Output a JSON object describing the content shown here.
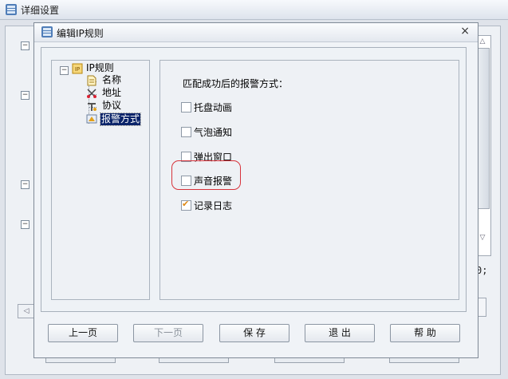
{
  "background_window": {
    "title": "详细设置",
    "semicolon_text": "0;"
  },
  "dialog": {
    "title": "编辑IP规则",
    "close_glyph": "×"
  },
  "tree": {
    "expander": "−",
    "root": "IP规则",
    "items": [
      {
        "label": "名称",
        "icon": "document-icon"
      },
      {
        "label": "地址",
        "icon": "address-icon"
      },
      {
        "label": "协议",
        "icon": "protocol-icon"
      },
      {
        "label": "报警方式",
        "icon": "alarm-icon",
        "selected": true
      }
    ]
  },
  "alarm_settings": {
    "title": "匹配成功后的报警方式：",
    "options": [
      {
        "label": "托盘动画",
        "checked": false
      },
      {
        "label": "气泡通知",
        "checked": false
      },
      {
        "label": "弹出窗口",
        "checked": false
      },
      {
        "label": "声音报警",
        "checked": false,
        "highlighted": true
      },
      {
        "label": "记录日志",
        "checked": true
      }
    ]
  },
  "buttons": {
    "prev": "上一页",
    "next": "下一页",
    "save": "保 存",
    "exit": "退 出",
    "help": "帮 助"
  },
  "colors": {
    "highlight_ring": "#d7333b",
    "selection": "#0a246a",
    "checkmark": "#e08a16"
  }
}
